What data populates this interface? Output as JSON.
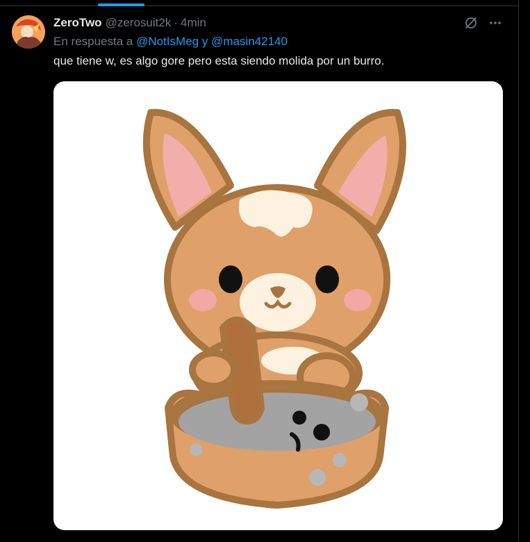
{
  "tweet": {
    "display_name": "ZeroTwo",
    "handle": "@zerosuit2k",
    "separator": "·",
    "time": "4min",
    "reply_prefix": "En respuesta a",
    "mention_1": "@NotIsMeg",
    "reply_joiner": "y",
    "mention_2": "@masin42140",
    "text": "que tiene w, es algo gore pero esta siendo molida por un burro."
  },
  "icons": {
    "grok": "grok-icon",
    "more": "more-icon",
    "avatar": "avatar"
  },
  "colors": {
    "background": "#000000",
    "text": "#e7e9ea",
    "secondary": "#71767b",
    "accent": "#1d9bf0",
    "border": "#2f3336"
  }
}
